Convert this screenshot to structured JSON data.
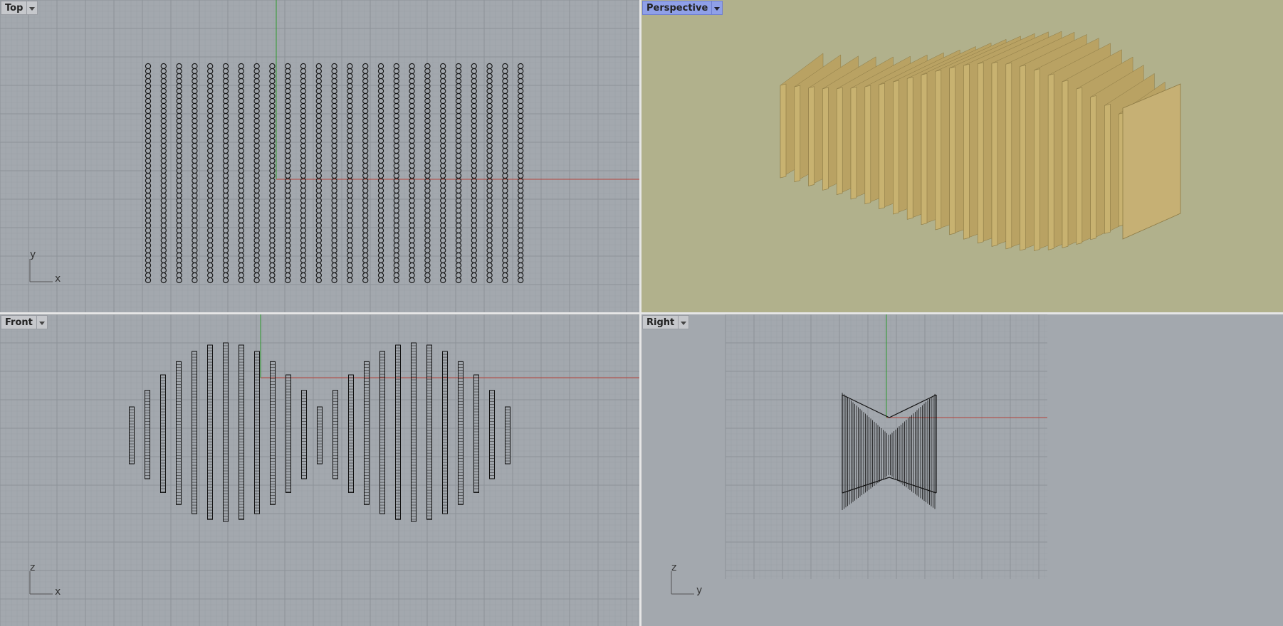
{
  "viewports": {
    "top": {
      "title": "Top",
      "axis_h": "x",
      "axis_v": "y"
    },
    "perspective": {
      "title": "Perspective"
    },
    "front": {
      "title": "Front",
      "axis_h": "x",
      "axis_v": "z"
    },
    "right": {
      "title": "Right",
      "axis_h": "y",
      "axis_v": "z"
    }
  },
  "colors": {
    "grid_bg": "#a3a8ae",
    "grid_minor": "#9ba0a6",
    "grid_major": "#8d9298",
    "perspective_bg": "#b1b18c",
    "wood": "#c8b270",
    "x_axis": "#b5443c",
    "y_axis": "#2e9a2e",
    "active_title": "#8fa0e8"
  },
  "icons": [
    "dropdown-arrow-icon",
    "axis-gizmo-icon"
  ]
}
